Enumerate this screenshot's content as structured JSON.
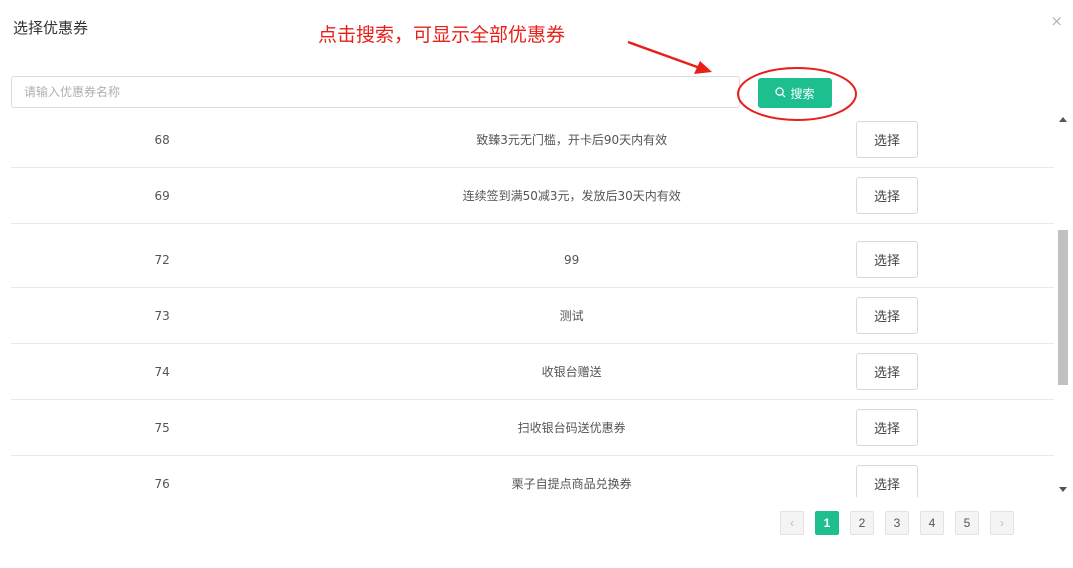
{
  "dialog": {
    "title": "选择优惠券",
    "close_glyph": "×"
  },
  "annotation": {
    "text": "点击搜索，可显示全部优惠券",
    "color": "#e8201a"
  },
  "search": {
    "placeholder": "请输入优惠券名称",
    "value": "",
    "button_label": "搜索",
    "button_icon": "search-icon",
    "accent": "#1dbf8e"
  },
  "table": {
    "rows": [
      {
        "id": "68",
        "name": "致臻3元无门槛，开卡后90天内有效",
        "action": "选择"
      },
      {
        "id": "69",
        "name": "连续签到满50减3元，发放后30天内有效",
        "action": "选择"
      },
      {
        "id": "72",
        "name": "99",
        "action": "选择"
      },
      {
        "id": "73",
        "name": "测试",
        "action": "选择"
      },
      {
        "id": "74",
        "name": "收银台赠送",
        "action": "选择"
      },
      {
        "id": "75",
        "name": "扫收银台码送优惠券",
        "action": "选择"
      },
      {
        "id": "76",
        "name": "栗子自提点商品兑换券",
        "action": "选择"
      }
    ]
  },
  "pagination": {
    "prev": "‹",
    "next": "›",
    "pages": [
      "1",
      "2",
      "3",
      "4",
      "5"
    ],
    "current": "1"
  }
}
